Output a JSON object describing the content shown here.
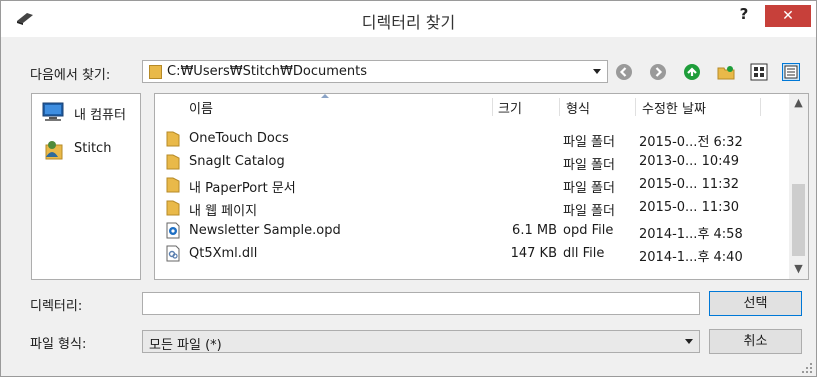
{
  "window": {
    "title": "디렉터리 찾기",
    "help_label": "?",
    "close_label": "✕"
  },
  "lookin": {
    "label": "다음에서 찾기:",
    "path": "C:₩Users₩Stitch₩Documents"
  },
  "places": [
    {
      "label": "내 컴퓨터",
      "icon": "computer-icon"
    },
    {
      "label": "Stitch",
      "icon": "user-folder-icon"
    }
  ],
  "columns": {
    "name": "이름",
    "size": "크기",
    "type": "형식",
    "date": "수정한 날짜"
  },
  "files": [
    {
      "name": "OneTouch Docs",
      "size": "",
      "type": "파일 폴더",
      "date": "2015-0...전 6:32",
      "icon": "folder-icon"
    },
    {
      "name": "SnagIt Catalog",
      "size": "",
      "type": "파일 폴더",
      "date": "2013-0... 10:49",
      "icon": "folder-icon"
    },
    {
      "name": "내 PaperPort 문서",
      "size": "",
      "type": "파일 폴더",
      "date": "2015-0... 11:32",
      "icon": "folder-icon"
    },
    {
      "name": "내 웹 페이지",
      "size": "",
      "type": "파일 폴더",
      "date": "2015-0... 11:30",
      "icon": "folder-icon"
    },
    {
      "name": "Newsletter Sample.opd",
      "size": "6.1 MB",
      "type": "opd File",
      "date": "2014-1...후 4:58",
      "icon": "opd-file-icon"
    },
    {
      "name": "Qt5Xml.dll",
      "size": "147 KB",
      "type": "dll File",
      "date": "2014-1...후 4:40",
      "icon": "dll-file-icon"
    }
  ],
  "directory": {
    "label": "디렉터리:",
    "value": ""
  },
  "filetype": {
    "label": "파일 형식:",
    "selected": "모든 파일 (*)"
  },
  "buttons": {
    "select": "선택",
    "cancel": "취소"
  },
  "colors": {
    "close_red": "#c7403a",
    "folder_yellow": "#e9b949",
    "accent_blue": "#0078d7"
  }
}
